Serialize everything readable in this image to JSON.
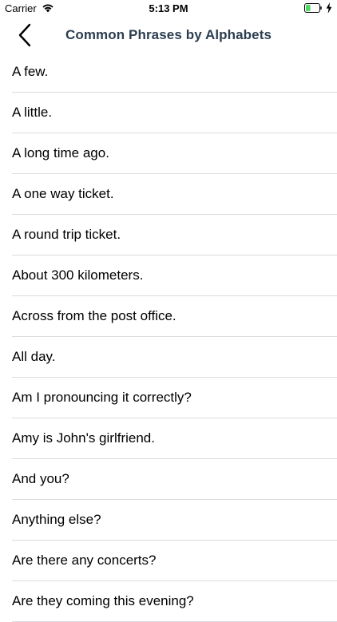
{
  "status_bar": {
    "carrier": "Carrier",
    "time": "5:13 PM",
    "wifi_icon": "wifi-icon",
    "battery_icon": "battery-icon",
    "battery_level": 0.35,
    "battery_color": "#4cd964",
    "charging_icon": "bolt-icon"
  },
  "nav": {
    "back_icon": "chevron-left-icon",
    "title": "Common Phrases by Alphabets",
    "title_color": "#2c3e50"
  },
  "phrases": [
    "A few.",
    "A little.",
    "A long time ago.",
    "A one way ticket.",
    "A round trip ticket.",
    "About 300 kilometers.",
    "Across from the post office.",
    "All day.",
    "Am I pronouncing it correctly?",
    "Amy is John's girlfriend.",
    "And you?",
    "Anything else?",
    "Are there any concerts?",
    "Are they coming this evening?"
  ]
}
